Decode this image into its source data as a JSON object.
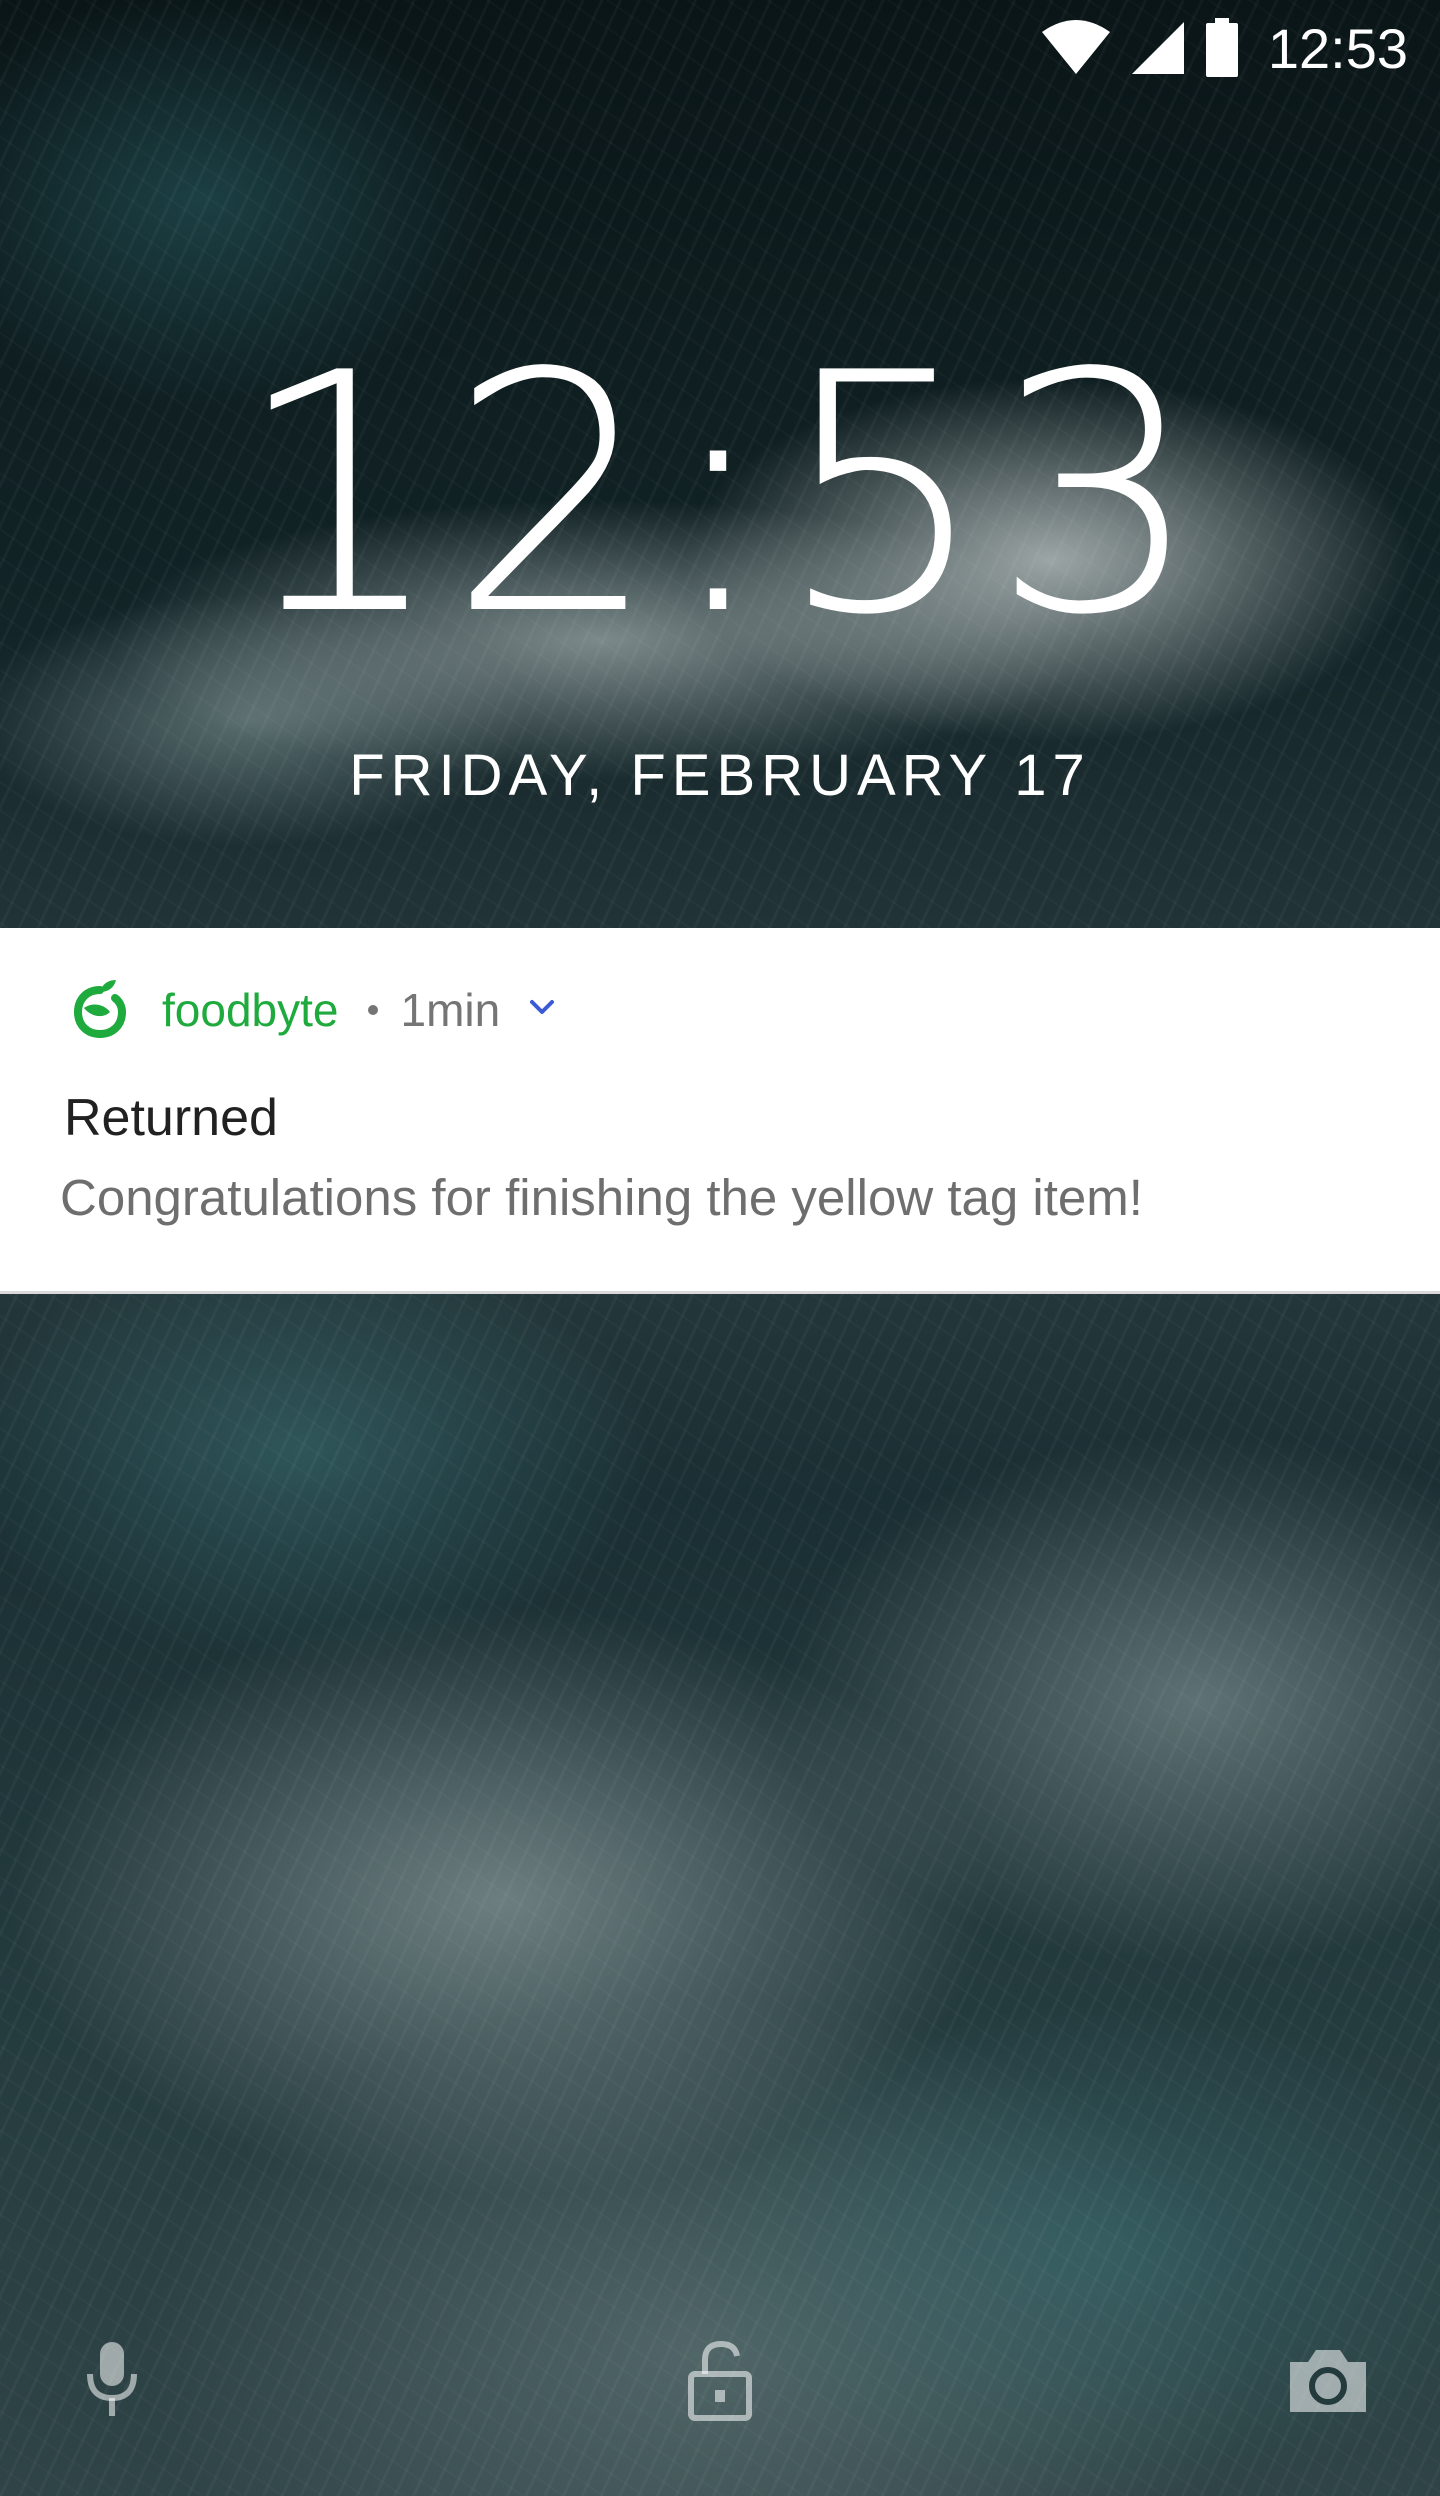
{
  "status_bar": {
    "time": "12:53",
    "icons": [
      "wifi-icon",
      "cell-signal-icon",
      "battery-icon"
    ]
  },
  "lockscreen": {
    "clock": "12:53",
    "date": "FRIDAY, FEBRUARY 17"
  },
  "notification": {
    "app_name": "foodbyte",
    "time": "1min",
    "title": "Returned",
    "body": "Congratulations for finishing the yellow tag item!",
    "app_color": "#1faa3d",
    "expand_color": "#3b5bd6"
  },
  "bottom_actions": {
    "left": "mic-icon",
    "center": "lock-icon",
    "right": "camera-icon"
  }
}
